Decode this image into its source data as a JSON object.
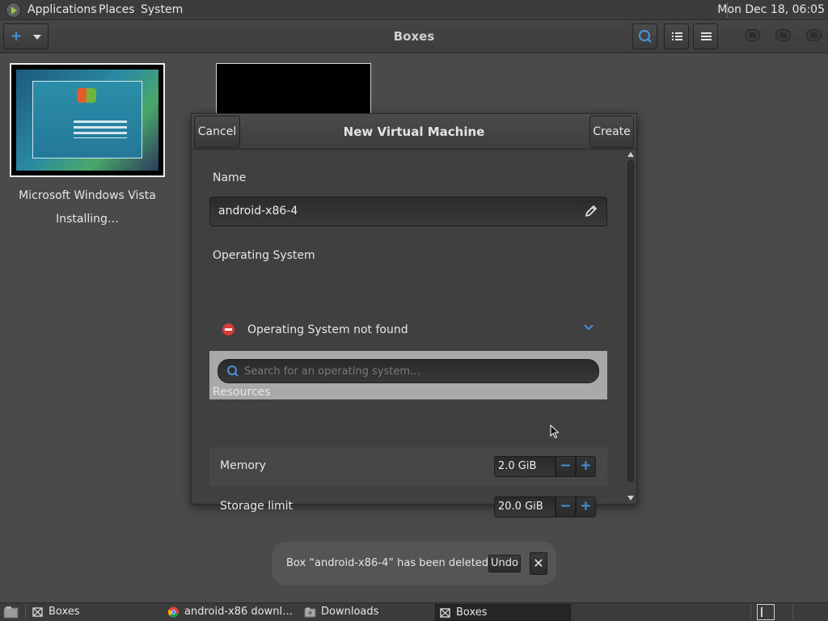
{
  "top_panel": {
    "menus": [
      "Applications",
      "Places",
      "System"
    ],
    "clock": "Mon Dec 18, 06:05"
  },
  "headerbar": {
    "title": "Boxes"
  },
  "boxes": [
    {
      "name": "Microsoft Windows Vista",
      "status": "Installing…"
    }
  ],
  "dialog": {
    "title": "New Virtual Machine",
    "cancel_label": "Cancel",
    "create_label": "Create",
    "name_label": "Name",
    "name_value": "android-x86-4",
    "os_label": "Operating System",
    "os_status": "Operating System not found",
    "os_search_placeholder": "Search for an operating system…",
    "resources_label": "Resources",
    "memory_label": "Memory",
    "memory_value": "2.0 GiB",
    "storage_label": "Storage limit",
    "storage_value": "20.0 GiB"
  },
  "notification": {
    "message": "Box “android-x86-4” has been deleted",
    "undo_label": "Undo",
    "close_label": "✕"
  },
  "taskbar": {
    "tasks": [
      "Boxes",
      "android-x86 downl…",
      "Downloads",
      "Boxes"
    ]
  },
  "colors": {
    "accent": "#4a90d9",
    "error": "#d93a3a"
  }
}
